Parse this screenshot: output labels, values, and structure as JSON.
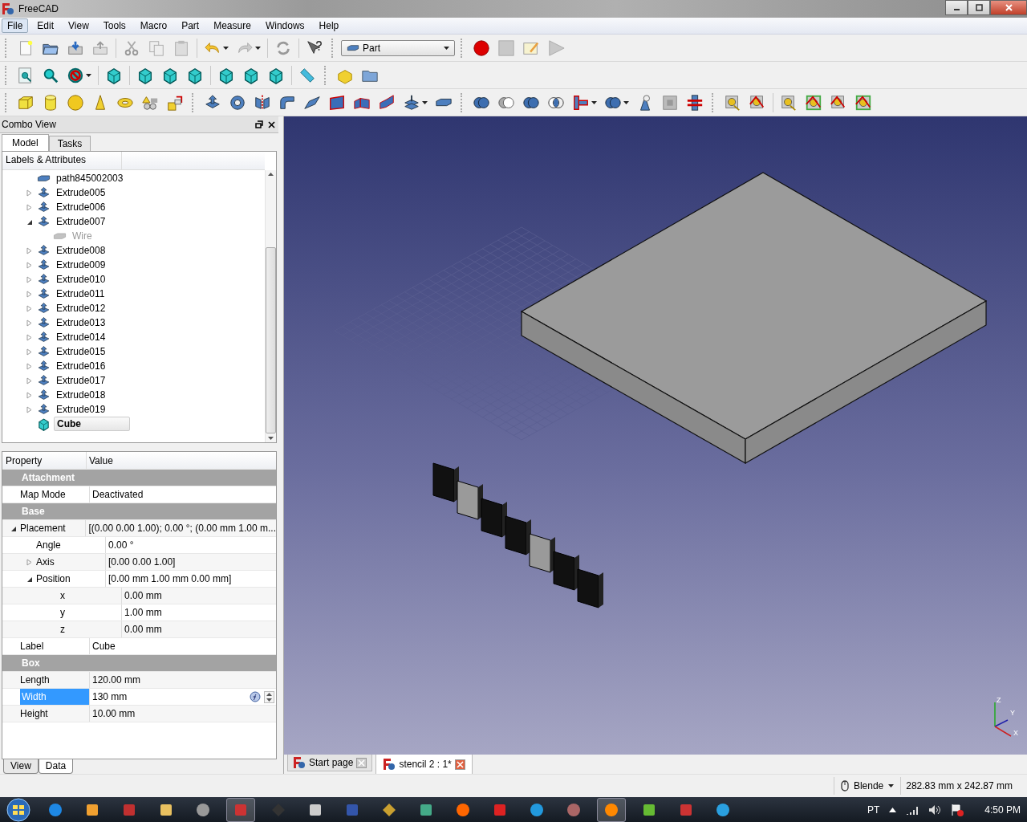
{
  "window": {
    "title": "FreeCAD"
  },
  "menu": [
    {
      "label": "File",
      "selected": true
    },
    {
      "label": "Edit",
      "selected": false
    },
    {
      "label": "View",
      "selected": false
    },
    {
      "label": "Tools",
      "selected": false
    },
    {
      "label": "Macro",
      "selected": false
    },
    {
      "label": "Part",
      "selected": false
    },
    {
      "label": "Measure",
      "selected": false
    },
    {
      "label": "Windows",
      "selected": false
    },
    {
      "label": "Help",
      "selected": false
    }
  ],
  "workbench": {
    "value": "Part"
  },
  "combo_view": {
    "title": "Combo View",
    "tabs": [
      {
        "label": "Model",
        "selected": true
      },
      {
        "label": "Tasks",
        "selected": false
      }
    ],
    "tree": {
      "header": "Labels & Attributes",
      "items": [
        {
          "label": "path845002003",
          "kind": "solid",
          "visible": true,
          "selected": false
        },
        {
          "label": "Extrude005",
          "kind": "extrude",
          "expanded": false,
          "visible": true,
          "selected": false
        },
        {
          "label": "Extrude006",
          "kind": "extrude",
          "expanded": false,
          "visible": true,
          "selected": false
        },
        {
          "label": "Extrude007",
          "kind": "extrude",
          "expanded": true,
          "visible": true,
          "selected": false,
          "children": [
            {
              "label": "Wire",
              "kind": "solid",
              "visible": false,
              "selected": false
            }
          ]
        },
        {
          "label": "Extrude008",
          "kind": "extrude",
          "expanded": false,
          "visible": true,
          "selected": false
        },
        {
          "label": "Extrude009",
          "kind": "extrude",
          "expanded": false,
          "visible": true,
          "selected": false
        },
        {
          "label": "Extrude010",
          "kind": "extrude",
          "expanded": false,
          "visible": true,
          "selected": false
        },
        {
          "label": "Extrude011",
          "kind": "extrude",
          "expanded": false,
          "visible": true,
          "selected": false
        },
        {
          "label": "Extrude012",
          "kind": "extrude",
          "expanded": false,
          "visible": true,
          "selected": false
        },
        {
          "label": "Extrude013",
          "kind": "extrude",
          "expanded": false,
          "visible": true,
          "selected": false
        },
        {
          "label": "Extrude014",
          "kind": "extrude",
          "expanded": false,
          "visible": true,
          "selected": false
        },
        {
          "label": "Extrude015",
          "kind": "extrude",
          "expanded": false,
          "visible": true,
          "selected": false
        },
        {
          "label": "Extrude016",
          "kind": "extrude",
          "expanded": false,
          "visible": true,
          "selected": false
        },
        {
          "label": "Extrude017",
          "kind": "extrude",
          "expanded": false,
          "visible": true,
          "selected": false
        },
        {
          "label": "Extrude018",
          "kind": "extrude",
          "expanded": false,
          "visible": true,
          "selected": false
        },
        {
          "label": "Extrude019",
          "kind": "extrude",
          "expanded": false,
          "visible": true,
          "selected": false
        },
        {
          "label": "Cube",
          "kind": "box",
          "visible": true,
          "selected": true
        }
      ]
    },
    "properties": {
      "columns": [
        "Property",
        "Value"
      ],
      "rows": [
        {
          "kind": "group",
          "name": "Attachment"
        },
        {
          "kind": "property",
          "name": "Map Mode",
          "value": "Deactivated",
          "selected": false
        },
        {
          "kind": "group",
          "name": "Base"
        },
        {
          "kind": "property",
          "name": "Placement",
          "value": "[(0.00 0.00 1.00); 0.00 °; (0.00 mm  1.00 m...",
          "selected": false,
          "expanded": true,
          "children": [
            {
              "kind": "property",
              "name": "Angle",
              "value": "0.00 °",
              "selected": false
            },
            {
              "kind": "property",
              "name": "Axis",
              "value": "[0.00 0.00 1.00]",
              "selected": false,
              "expanded": false
            },
            {
              "kind": "property",
              "name": "Position",
              "value": "[0.00 mm  1.00 mm  0.00 mm]",
              "selected": false,
              "expanded": true,
              "children": [
                {
                  "kind": "property",
                  "name": "x",
                  "value": "0.00 mm",
                  "selected": false
                },
                {
                  "kind": "property",
                  "name": "y",
                  "value": "1.00 mm",
                  "selected": false
                },
                {
                  "kind": "property",
                  "name": "z",
                  "value": "0.00 mm",
                  "selected": false
                }
              ]
            }
          ]
        },
        {
          "kind": "property",
          "name": "Label",
          "value": "Cube",
          "selected": false
        },
        {
          "kind": "group",
          "name": "Box"
        },
        {
          "kind": "property",
          "name": "Length",
          "value": "120.00 mm",
          "selected": false
        },
        {
          "kind": "property",
          "name": "Width",
          "value": "130 mm",
          "selected": true
        },
        {
          "kind": "property",
          "name": "Height",
          "value": "10.00 mm",
          "selected": false
        }
      ]
    },
    "bottom_tabs": [
      {
        "label": "View",
        "selected": false
      },
      {
        "label": "Data",
        "selected": true
      }
    ]
  },
  "viewport": {
    "axis_labels": {
      "z": "Z",
      "y": "Y",
      "x": "X"
    }
  },
  "document_tabs": [
    {
      "label": "Start page",
      "selected": false
    },
    {
      "label": "stencil 2 : 1*",
      "selected": true
    }
  ],
  "status_bar": {
    "navigation": "Blende",
    "dimensions": "282.83 mm x 242.87 mm"
  },
  "taskbar": {
    "language": "PT",
    "time": "4:50 PM"
  }
}
